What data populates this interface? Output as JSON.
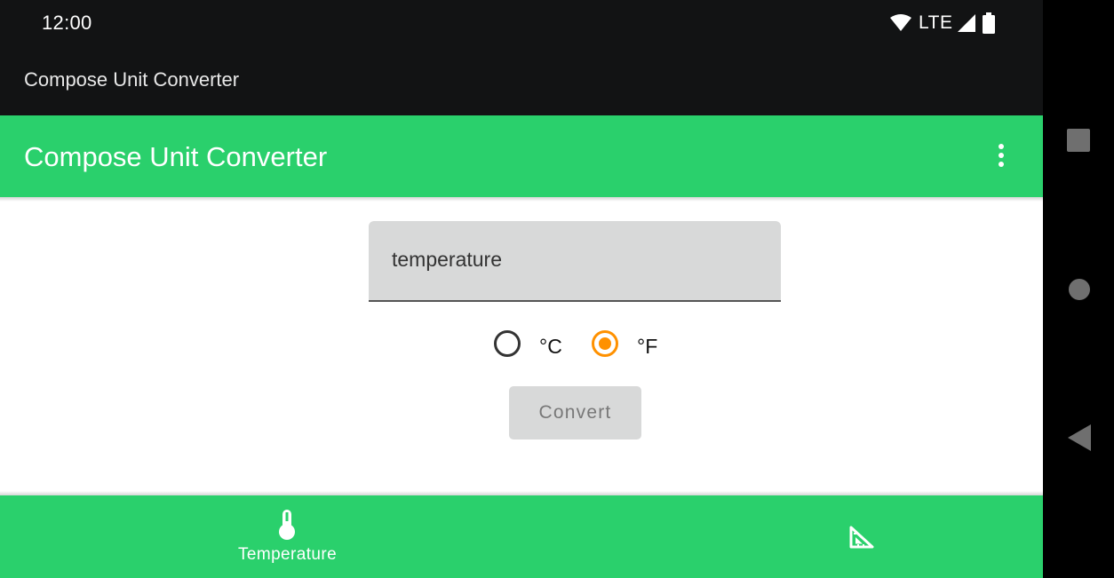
{
  "status_bar": {
    "time": "12:00",
    "network": "LTE",
    "icons": [
      "wifi-icon",
      "signal-icon",
      "battery-icon"
    ]
  },
  "task_header": {
    "title": "Compose Unit Converter"
  },
  "app_bar": {
    "title": "Compose Unit Converter",
    "menu_icon": "overflow-menu-icon"
  },
  "temperature_screen": {
    "input": {
      "value": "",
      "placeholder": "temperature"
    },
    "units": [
      {
        "label": "°C",
        "selected": false
      },
      {
        "label": "°F",
        "selected": true
      }
    ],
    "convert_label": "Convert"
  },
  "bottom_nav": {
    "items": [
      {
        "label": "Temperature",
        "icon": "thermometer-icon",
        "selected": true
      },
      {
        "label": "",
        "icon": "triangle-ruler-icon",
        "selected": false
      }
    ]
  },
  "system_nav": [
    "recents-icon",
    "home-icon",
    "back-icon"
  ],
  "colors": {
    "accent_green": "#2ad06c",
    "radio_selected": "#ff9100",
    "status_bar": "#121314"
  }
}
